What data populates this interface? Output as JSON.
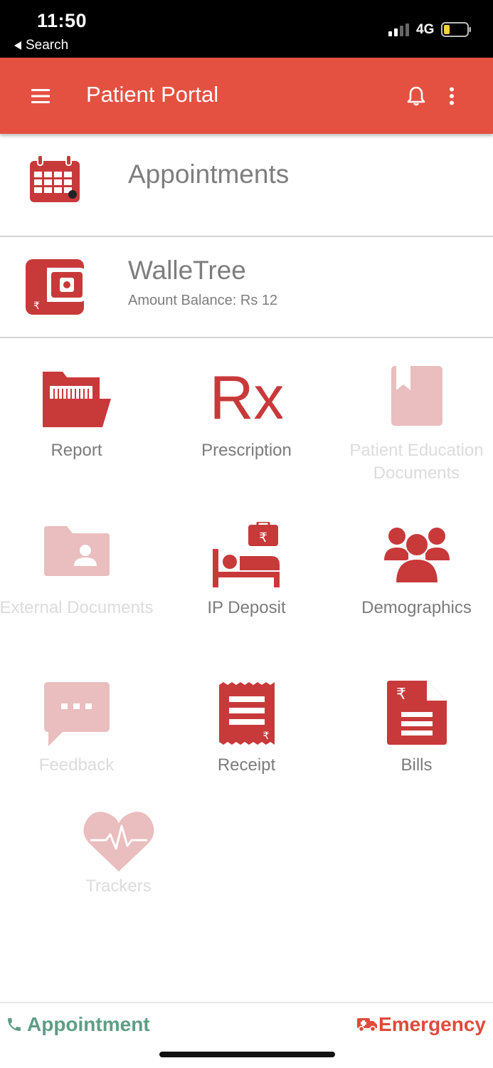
{
  "status_bar": {
    "time": "11:50",
    "back_label": "Search",
    "network": "4G"
  },
  "header": {
    "title": "Patient Portal",
    "icons": [
      "hamburger-menu-icon",
      "bell-icon",
      "more-vert-icon"
    ]
  },
  "rows": {
    "appointments": {
      "title": "Appointments",
      "icon": "calendar-icon"
    },
    "wallet": {
      "title": "WalleTree",
      "subtitle": "Amount Balance: Rs 12",
      "icon": "wallet-icon"
    }
  },
  "tiles": [
    {
      "label": "Report",
      "icon": "folder-report-icon",
      "enabled": true
    },
    {
      "label": "Prescription",
      "icon": "rx-icon",
      "enabled": true
    },
    {
      "label": "Patient Education Documents",
      "icon": "bookmark-book-icon",
      "enabled": false
    },
    {
      "label": "External Documents",
      "icon": "folder-user-icon",
      "enabled": false
    },
    {
      "label": "IP Deposit",
      "icon": "bed-deposit-icon",
      "enabled": true
    },
    {
      "label": "Demographics",
      "icon": "group-icon",
      "enabled": true
    },
    {
      "label": "Feedback",
      "icon": "chat-bubble-icon",
      "enabled": false
    },
    {
      "label": "Receipt",
      "icon": "receipt-icon",
      "enabled": true
    },
    {
      "label": "Bills",
      "icon": "bill-document-icon",
      "enabled": true
    },
    {
      "label": "Trackers",
      "icon": "heart-pulse-icon",
      "enabled": false
    }
  ],
  "rx_text": "Rx",
  "bottom_bar": {
    "appointment_label": "Appointment",
    "emergency_label": "Emergency"
  },
  "colors": {
    "brand": "#e45141",
    "icon_red": "#c8393a",
    "icon_disabled": "#eabdbe",
    "appointment_green": "#5f9d84",
    "emergency_red": "#e04a3b"
  }
}
